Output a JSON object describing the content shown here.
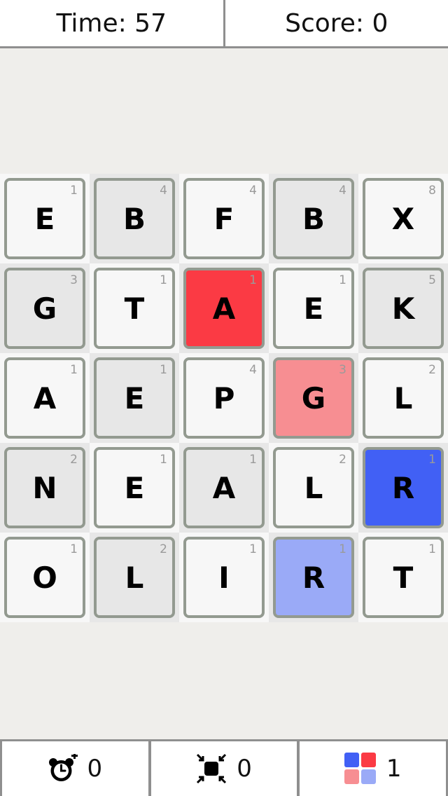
{
  "header": {
    "time_text": "Time: 57",
    "score_text": "Score: 0"
  },
  "board": {
    "rows": [
      [
        {
          "letter": "E",
          "points": "1",
          "state": "normal"
        },
        {
          "letter": "B",
          "points": "4",
          "state": "normal"
        },
        {
          "letter": "F",
          "points": "4",
          "state": "normal"
        },
        {
          "letter": "B",
          "points": "4",
          "state": "normal"
        },
        {
          "letter": "X",
          "points": "8",
          "state": "normal"
        }
      ],
      [
        {
          "letter": "G",
          "points": "3",
          "state": "normal"
        },
        {
          "letter": "T",
          "points": "1",
          "state": "normal"
        },
        {
          "letter": "A",
          "points": "1",
          "state": "red"
        },
        {
          "letter": "E",
          "points": "1",
          "state": "normal"
        },
        {
          "letter": "K",
          "points": "5",
          "state": "normal"
        }
      ],
      [
        {
          "letter": "A",
          "points": "1",
          "state": "normal"
        },
        {
          "letter": "E",
          "points": "1",
          "state": "normal"
        },
        {
          "letter": "P",
          "points": "4",
          "state": "normal"
        },
        {
          "letter": "G",
          "points": "3",
          "state": "light-red"
        },
        {
          "letter": "L",
          "points": "2",
          "state": "normal"
        }
      ],
      [
        {
          "letter": "N",
          "points": "2",
          "state": "normal"
        },
        {
          "letter": "E",
          "points": "1",
          "state": "normal"
        },
        {
          "letter": "A",
          "points": "1",
          "state": "normal"
        },
        {
          "letter": "L",
          "points": "2",
          "state": "normal"
        },
        {
          "letter": "R",
          "points": "1",
          "state": "blue"
        }
      ],
      [
        {
          "letter": "O",
          "points": "1",
          "state": "normal"
        },
        {
          "letter": "L",
          "points": "2",
          "state": "normal"
        },
        {
          "letter": "I",
          "points": "1",
          "state": "normal"
        },
        {
          "letter": "R",
          "points": "1",
          "state": "light-blue"
        },
        {
          "letter": "T",
          "points": "1",
          "state": "normal"
        }
      ]
    ]
  },
  "powerups": [
    {
      "icon": "alarm-clock-plus-icon",
      "count": "0"
    },
    {
      "icon": "shrink-arrows-icon",
      "count": "0"
    },
    {
      "icon": "color-squares-icon",
      "count": "1"
    }
  ],
  "colors": {
    "red": "#fb3a44",
    "light-red": "#f78e92",
    "blue": "#4160f5",
    "light-blue": "#9aaaf7",
    "tile-light": "#f7f7f7",
    "tile-dark": "#e7e7e7",
    "tile-border": "#939a90"
  }
}
